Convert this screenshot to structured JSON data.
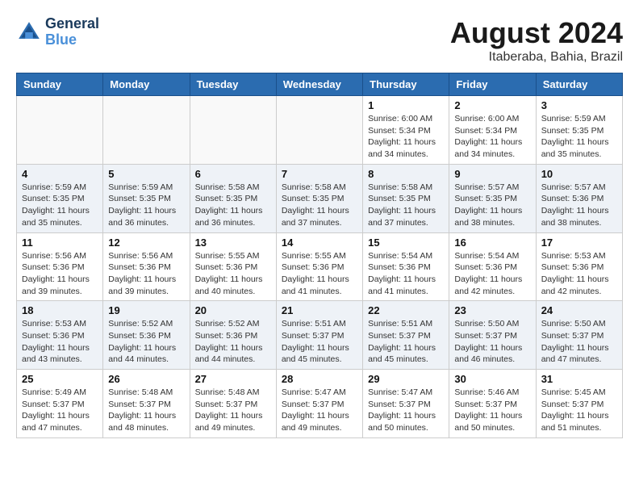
{
  "header": {
    "logo_line1": "General",
    "logo_line2": "Blue",
    "month_year": "August 2024",
    "location": "Itaberaba, Bahia, Brazil"
  },
  "days_of_week": [
    "Sunday",
    "Monday",
    "Tuesday",
    "Wednesday",
    "Thursday",
    "Friday",
    "Saturday"
  ],
  "weeks": [
    [
      {
        "day": "",
        "sunrise": "",
        "sunset": "",
        "daylight": ""
      },
      {
        "day": "",
        "sunrise": "",
        "sunset": "",
        "daylight": ""
      },
      {
        "day": "",
        "sunrise": "",
        "sunset": "",
        "daylight": ""
      },
      {
        "day": "",
        "sunrise": "",
        "sunset": "",
        "daylight": ""
      },
      {
        "day": "1",
        "sunrise": "Sunrise: 6:00 AM",
        "sunset": "Sunset: 5:34 PM",
        "daylight": "Daylight: 11 hours and 34 minutes."
      },
      {
        "day": "2",
        "sunrise": "Sunrise: 6:00 AM",
        "sunset": "Sunset: 5:34 PM",
        "daylight": "Daylight: 11 hours and 34 minutes."
      },
      {
        "day": "3",
        "sunrise": "Sunrise: 5:59 AM",
        "sunset": "Sunset: 5:35 PM",
        "daylight": "Daylight: 11 hours and 35 minutes."
      }
    ],
    [
      {
        "day": "4",
        "sunrise": "Sunrise: 5:59 AM",
        "sunset": "Sunset: 5:35 PM",
        "daylight": "Daylight: 11 hours and 35 minutes."
      },
      {
        "day": "5",
        "sunrise": "Sunrise: 5:59 AM",
        "sunset": "Sunset: 5:35 PM",
        "daylight": "Daylight: 11 hours and 36 minutes."
      },
      {
        "day": "6",
        "sunrise": "Sunrise: 5:58 AM",
        "sunset": "Sunset: 5:35 PM",
        "daylight": "Daylight: 11 hours and 36 minutes."
      },
      {
        "day": "7",
        "sunrise": "Sunrise: 5:58 AM",
        "sunset": "Sunset: 5:35 PM",
        "daylight": "Daylight: 11 hours and 37 minutes."
      },
      {
        "day": "8",
        "sunrise": "Sunrise: 5:58 AM",
        "sunset": "Sunset: 5:35 PM",
        "daylight": "Daylight: 11 hours and 37 minutes."
      },
      {
        "day": "9",
        "sunrise": "Sunrise: 5:57 AM",
        "sunset": "Sunset: 5:35 PM",
        "daylight": "Daylight: 11 hours and 38 minutes."
      },
      {
        "day": "10",
        "sunrise": "Sunrise: 5:57 AM",
        "sunset": "Sunset: 5:36 PM",
        "daylight": "Daylight: 11 hours and 38 minutes."
      }
    ],
    [
      {
        "day": "11",
        "sunrise": "Sunrise: 5:56 AM",
        "sunset": "Sunset: 5:36 PM",
        "daylight": "Daylight: 11 hours and 39 minutes."
      },
      {
        "day": "12",
        "sunrise": "Sunrise: 5:56 AM",
        "sunset": "Sunset: 5:36 PM",
        "daylight": "Daylight: 11 hours and 39 minutes."
      },
      {
        "day": "13",
        "sunrise": "Sunrise: 5:55 AM",
        "sunset": "Sunset: 5:36 PM",
        "daylight": "Daylight: 11 hours and 40 minutes."
      },
      {
        "day": "14",
        "sunrise": "Sunrise: 5:55 AM",
        "sunset": "Sunset: 5:36 PM",
        "daylight": "Daylight: 11 hours and 41 minutes."
      },
      {
        "day": "15",
        "sunrise": "Sunrise: 5:54 AM",
        "sunset": "Sunset: 5:36 PM",
        "daylight": "Daylight: 11 hours and 41 minutes."
      },
      {
        "day": "16",
        "sunrise": "Sunrise: 5:54 AM",
        "sunset": "Sunset: 5:36 PM",
        "daylight": "Daylight: 11 hours and 42 minutes."
      },
      {
        "day": "17",
        "sunrise": "Sunrise: 5:53 AM",
        "sunset": "Sunset: 5:36 PM",
        "daylight": "Daylight: 11 hours and 42 minutes."
      }
    ],
    [
      {
        "day": "18",
        "sunrise": "Sunrise: 5:53 AM",
        "sunset": "Sunset: 5:36 PM",
        "daylight": "Daylight: 11 hours and 43 minutes."
      },
      {
        "day": "19",
        "sunrise": "Sunrise: 5:52 AM",
        "sunset": "Sunset: 5:36 PM",
        "daylight": "Daylight: 11 hours and 44 minutes."
      },
      {
        "day": "20",
        "sunrise": "Sunrise: 5:52 AM",
        "sunset": "Sunset: 5:36 PM",
        "daylight": "Daylight: 11 hours and 44 minutes."
      },
      {
        "day": "21",
        "sunrise": "Sunrise: 5:51 AM",
        "sunset": "Sunset: 5:37 PM",
        "daylight": "Daylight: 11 hours and 45 minutes."
      },
      {
        "day": "22",
        "sunrise": "Sunrise: 5:51 AM",
        "sunset": "Sunset: 5:37 PM",
        "daylight": "Daylight: 11 hours and 45 minutes."
      },
      {
        "day": "23",
        "sunrise": "Sunrise: 5:50 AM",
        "sunset": "Sunset: 5:37 PM",
        "daylight": "Daylight: 11 hours and 46 minutes."
      },
      {
        "day": "24",
        "sunrise": "Sunrise: 5:50 AM",
        "sunset": "Sunset: 5:37 PM",
        "daylight": "Daylight: 11 hours and 47 minutes."
      }
    ],
    [
      {
        "day": "25",
        "sunrise": "Sunrise: 5:49 AM",
        "sunset": "Sunset: 5:37 PM",
        "daylight": "Daylight: 11 hours and 47 minutes."
      },
      {
        "day": "26",
        "sunrise": "Sunrise: 5:48 AM",
        "sunset": "Sunset: 5:37 PM",
        "daylight": "Daylight: 11 hours and 48 minutes."
      },
      {
        "day": "27",
        "sunrise": "Sunrise: 5:48 AM",
        "sunset": "Sunset: 5:37 PM",
        "daylight": "Daylight: 11 hours and 49 minutes."
      },
      {
        "day": "28",
        "sunrise": "Sunrise: 5:47 AM",
        "sunset": "Sunset: 5:37 PM",
        "daylight": "Daylight: 11 hours and 49 minutes."
      },
      {
        "day": "29",
        "sunrise": "Sunrise: 5:47 AM",
        "sunset": "Sunset: 5:37 PM",
        "daylight": "Daylight: 11 hours and 50 minutes."
      },
      {
        "day": "30",
        "sunrise": "Sunrise: 5:46 AM",
        "sunset": "Sunset: 5:37 PM",
        "daylight": "Daylight: 11 hours and 50 minutes."
      },
      {
        "day": "31",
        "sunrise": "Sunrise: 5:45 AM",
        "sunset": "Sunset: 5:37 PM",
        "daylight": "Daylight: 11 hours and 51 minutes."
      }
    ]
  ]
}
